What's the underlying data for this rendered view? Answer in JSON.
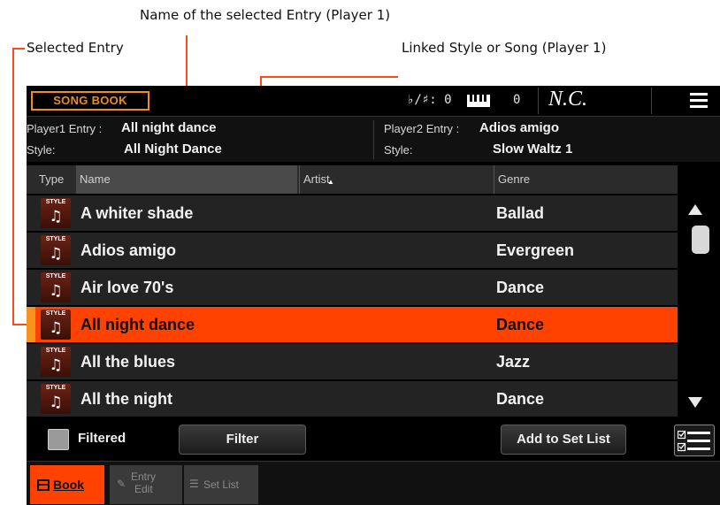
{
  "callouts": {
    "name_selected": "Name of the selected Entry (Player 1)",
    "selected_entry": "Selected Entry",
    "linked_style": "Linked Style or Song (Player 1)"
  },
  "topbar": {
    "title": "SONG BOOK",
    "transpose_label": "♭/♯:",
    "transpose_value": "0",
    "octave_value": "0",
    "chord": "N.C."
  },
  "info": {
    "player1_entry_label": "Player1 Entry :",
    "player1_entry_value": "All night dance",
    "player1_style_label": "Style:",
    "player1_style_value": "All Night Dance",
    "player2_entry_label": "Player2 Entry :",
    "player2_entry_value": "Adios amigo",
    "player2_style_label": "Style:",
    "player2_style_value": "Slow Waltz 1"
  },
  "table": {
    "headers": {
      "type": "Type",
      "name": "Name",
      "artist": "Artist",
      "genre": "Genre"
    },
    "type_label": "STYLE",
    "rows": [
      {
        "name": "A whiter shade",
        "artist": "",
        "genre": "Ballad"
      },
      {
        "name": "Adios amigo",
        "artist": "",
        "genre": "Evergreen"
      },
      {
        "name": "Air love 70's",
        "artist": "",
        "genre": "Dance"
      },
      {
        "name": "All night dance",
        "artist": "",
        "genre": "Dance",
        "selected": true
      },
      {
        "name": "All the blues",
        "artist": "",
        "genre": "Jazz"
      },
      {
        "name": "All the night",
        "artist": "",
        "genre": "Dance"
      }
    ]
  },
  "bottom": {
    "filtered_label": "Filtered",
    "filter_button": "Filter",
    "add_set_list_button": "Add to Set List"
  },
  "tabs": {
    "book": "Book",
    "entry_edit_line1": "Entry",
    "entry_edit_line2": "Edit",
    "set_list": "Set List"
  },
  "colors": {
    "accent": "#ff4200",
    "title_border": "#f28c1c",
    "selected_tab_marker": "#f7941d",
    "callout_line": "#ff4a1c"
  }
}
